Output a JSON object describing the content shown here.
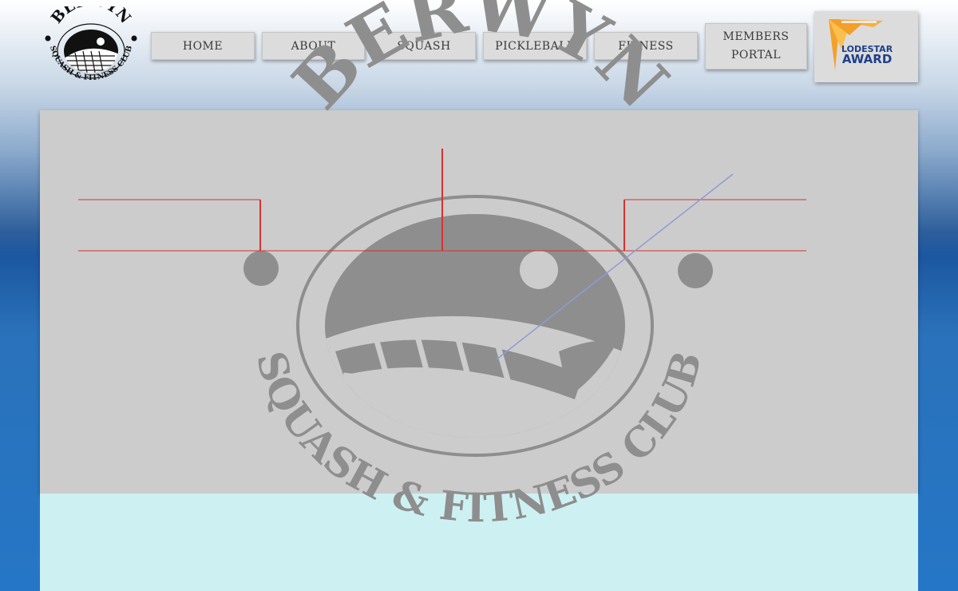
{
  "logo": {
    "top_text": "BERWYN",
    "bottom_text": "SQUASH & FITNESS CLUB",
    "icon": "squash-racket-ball-icon"
  },
  "nav": {
    "items": [
      {
        "label": "HOME"
      },
      {
        "label": "ABOUT"
      },
      {
        "label": "SQUASH"
      },
      {
        "label": "PICKLEBALL"
      },
      {
        "label": "FITNESS"
      }
    ],
    "members_line1": "MEMBERS",
    "members_line2": "PORTAL"
  },
  "award": {
    "line1": "LODESTAR",
    "line2": "AWARD",
    "icon": "sunburst-icon",
    "colors": {
      "orange": "#f4a12a",
      "navy": "#1e3f8a"
    }
  },
  "hero": {
    "watermark_top": "BERWYN",
    "watermark_bottom": "SQUASH & FITNESS CLUB",
    "colors": {
      "panel": "#cccccc",
      "watermark": "#8e8e8e"
    }
  },
  "content": {
    "background": "#cdf1f3"
  }
}
